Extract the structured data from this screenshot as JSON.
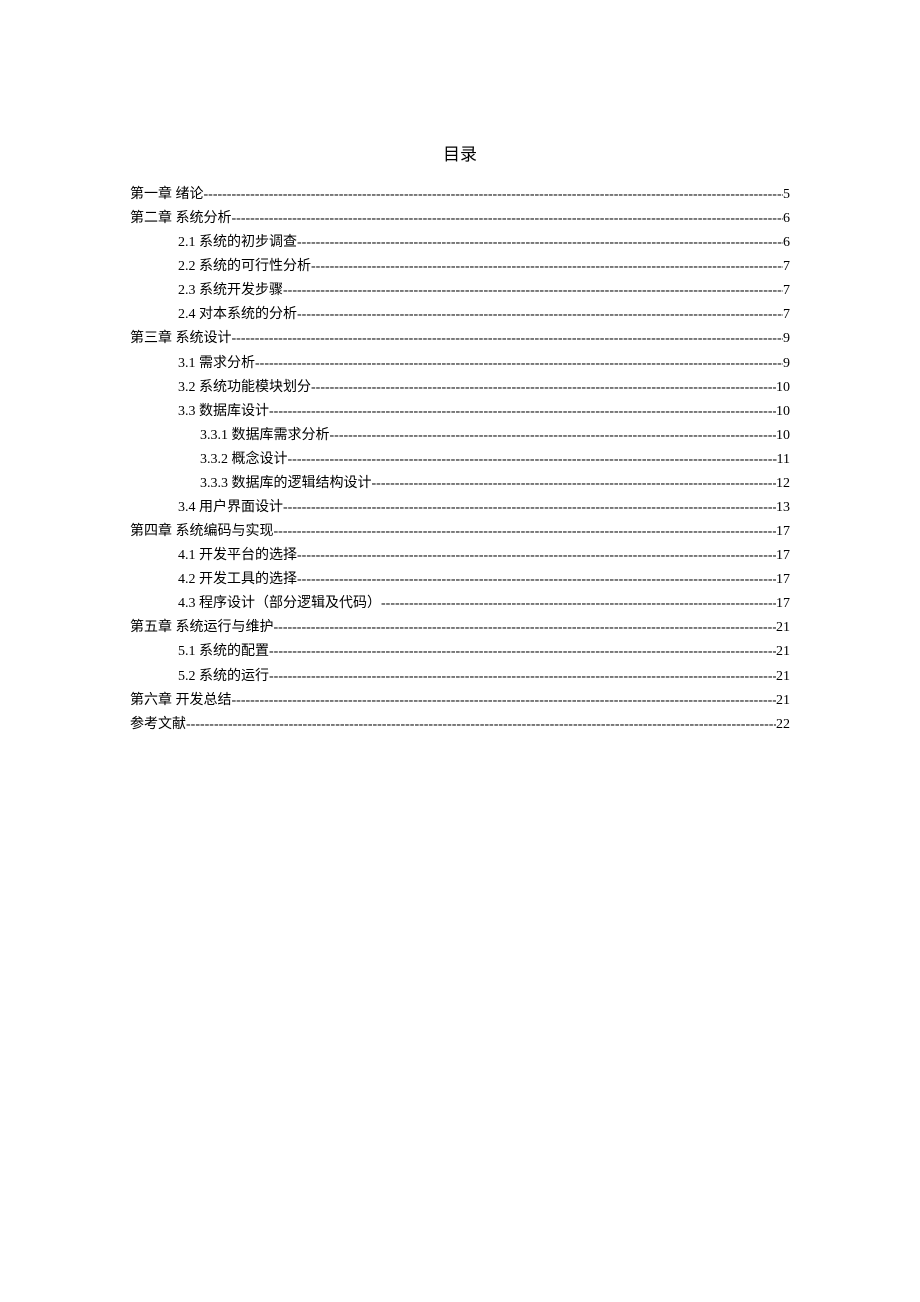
{
  "title": "目录",
  "entries": [
    {
      "level": 0,
      "label": "第一章   绪论",
      "page": "5"
    },
    {
      "level": 0,
      "label": "第二章   系统分析",
      "page": "6"
    },
    {
      "level": 1,
      "label": "2.1  系统的初步调查",
      "page": "6"
    },
    {
      "level": 1,
      "label": "2.2  系统的可行性分析",
      "page": "7"
    },
    {
      "level": 1,
      "label": "2.3  系统开发步骤",
      "page": "7"
    },
    {
      "level": 1,
      "label": "2.4 对本系统的分析",
      "page": "7"
    },
    {
      "level": 0,
      "label": "第三章   系统设计",
      "page": "9"
    },
    {
      "level": 1,
      "label": "3.1 需求分析",
      "page": "9"
    },
    {
      "level": 1,
      "label": "3.2 系统功能模块划分",
      "page": "10"
    },
    {
      "level": 1,
      "label": "3.3 数据库设计",
      "page": "10"
    },
    {
      "level": 2,
      "label": "3.3.1 数据库需求分析",
      "page": "10"
    },
    {
      "level": 2,
      "label": "3.3.2 概念设计",
      "page": "11"
    },
    {
      "level": 2,
      "label": "3.3.3 数据库的逻辑结构设计",
      "page": "12"
    },
    {
      "level": 1,
      "label": "3.4 用户界面设计",
      "page": "13"
    },
    {
      "level": 0,
      "label": "第四章   系统编码与实现",
      "page": "17"
    },
    {
      "level": 1,
      "label": "4.1 开发平台的选择",
      "page": "17"
    },
    {
      "level": 1,
      "label": "4.2 开发工具的选择",
      "page": "17"
    },
    {
      "level": 1,
      "label": "4.3 程序设计（部分逻辑及代码）",
      "page": "17"
    },
    {
      "level": 0,
      "label": "第五章   系统运行与维护",
      "page": "21"
    },
    {
      "level": 1,
      "label": "5.1 系统的配置",
      "page": "21"
    },
    {
      "level": 1,
      "label": "5.2 系统的运行",
      "page": "21"
    },
    {
      "level": 0,
      "label": "第六章   开发总结",
      "page": "21"
    },
    {
      "level": 0,
      "label": "参考文献",
      "page": "22"
    }
  ]
}
